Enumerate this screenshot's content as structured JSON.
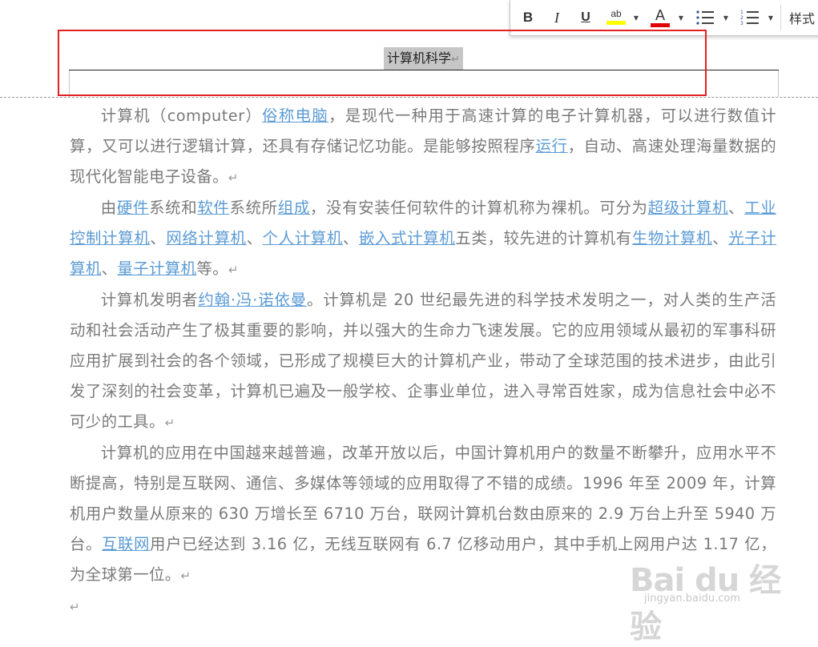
{
  "toolbar": {
    "bold": "B",
    "italic": "I",
    "underline": "U",
    "highlight_glyph": "ab",
    "font_color_glyph": "A",
    "styles_label": "样式",
    "colors": {
      "highlight": "#ffff00",
      "font_color": "#e00000"
    }
  },
  "header": {
    "title": "计算机科学",
    "para_mark": "↵"
  },
  "document": {
    "para_mark": "↵",
    "p1": {
      "t1": "计算机（computer）",
      "l1": "俗称电脑",
      "t2": "，是现代一种用于高速计算的电子计算机器，可以进行数值计算，又可以进行逻辑计算，还具有存储记忆功能。是能够按照程序",
      "l2": "运行",
      "t3": "，自动、高速处理海量数据的现代化智能电子设备。"
    },
    "p2": {
      "t1": "由",
      "l1": "硬件",
      "t2": "系统和",
      "l2": "软件",
      "t3": "系统所",
      "l3": "组成",
      "t4": "，没有安装任何软件的计算机称为裸机。可分为",
      "l4": "超级计算机",
      "t5": "、",
      "l5": "工业控制计算机",
      "t6": "、",
      "l6": "网络计算机",
      "t7": "、",
      "l7": "个人计算机",
      "t8": "、",
      "l8": "嵌入式计算机",
      "t9": "五类，较先进的计算机有",
      "l9": "生物计算机",
      "t10": "、",
      "l10": "光子计算机",
      "t11": "、",
      "l11": "量子计算机",
      "t12": "等。"
    },
    "p3": {
      "t1": "计算机发明者",
      "l1": "约翰·冯·诺依曼",
      "t2": "。计算机是 20 世纪最先进的科学技术发明之一，对人类的生产活动和社会活动产生了极其重要的影响，并以强大的生命力飞速发展。它的应用领域从最初的军事科研应用扩展到社会的各个领域，已形成了规模巨大的计算机产业，带动了全球范围的技术进步，由此引发了深刻的社会变革，计算机已遍及一般学校、企事业单位，进入寻常百姓家，成为信息社会中必不可少的工具。"
    },
    "p4": {
      "t1": "计算机的应用在中国越来越普遍，改革开放以后，中国计算机用户的数量不断攀升，应用水平不断提高，特别是互联网、通信、多媒体等领域的应用取得了不错的成绩。1996 年至 2009 年，计算机用户数量从原来的 630 万增长至 6710 万台，联网计算机台数由原来的 2.9 万台上升至 5940 万台。",
      "l1": "互联网",
      "t2": "用户已经达到 3.16 亿，无线互联网有 6.7 亿移动用户，其中手机上网用户达 1.17 亿，为全球第一位。"
    }
  },
  "watermark": {
    "logo": "Bai du 经验",
    "url": "jingyan.baidu.com"
  }
}
